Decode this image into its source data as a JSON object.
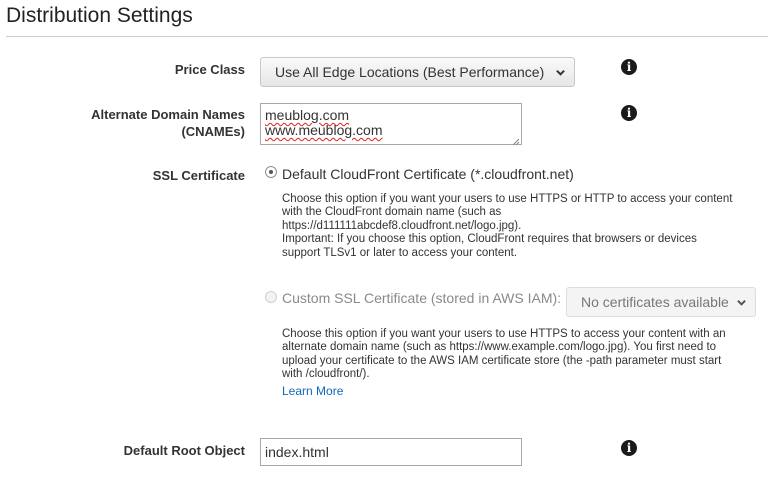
{
  "page": {
    "section_title": "Distribution Settings"
  },
  "price_class": {
    "label": "Price Class",
    "selected": "Use All Edge Locations (Best Performance)"
  },
  "cnames": {
    "label_line1": "Alternate Domain Names",
    "label_line2": "(CNAMEs)",
    "values": [
      "meublog.com",
      "www.meublog.com"
    ]
  },
  "ssl": {
    "label": "SSL Certificate",
    "default_option": {
      "label": "Default CloudFront Certificate (*.cloudfront.net)",
      "selected": true,
      "help_lines": [
        "Choose this option if you want your users to use HTTPS or HTTP to access your content",
        "with the CloudFront domain name (such as",
        "https://d111111abcdef8.cloudfront.net/logo.jpg).",
        "Important: If you choose this option, CloudFront requires that browsers or devices",
        "support TLSv1 or later to access your content."
      ]
    },
    "custom_option": {
      "label": "Custom SSL Certificate (stored in AWS IAM):",
      "selected": false,
      "disabled": true,
      "select_value": "No certificates available",
      "help_lines": [
        "Choose this option if you want your users to use HTTPS to access your content with an",
        "alternate domain name (such as https://www.example.com/logo.jpg). You first need to",
        "upload your certificate to the AWS IAM certificate store (the -path parameter must start",
        "with /cloudfront/)."
      ],
      "learn_more": "Learn More"
    }
  },
  "root_object": {
    "label": "Default Root Object",
    "value": "index.html"
  },
  "icons": {
    "info": "info-icon",
    "chevron": "chevron-down-icon"
  },
  "colors": {
    "link": "#1166bb",
    "info_icon": "#1a1a1a",
    "rule": "#cccccc"
  }
}
